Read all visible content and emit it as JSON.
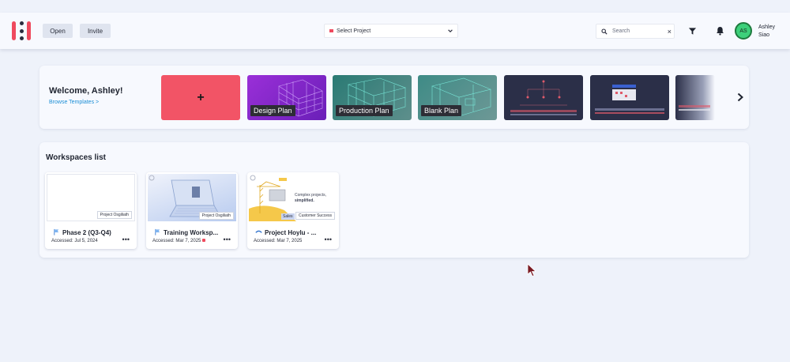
{
  "header": {
    "open_label": "Open",
    "invite_label": "Invite",
    "select_project_label": "Select Project",
    "search_placeholder": "Search",
    "search_clear": "×",
    "avatar_initials": "AS",
    "user_first": "Ashley",
    "user_last": "Siao"
  },
  "welcome": {
    "title": "Welcome, Ashley!",
    "browse_link": "Browse Templates >",
    "new_label": "+",
    "templates": [
      {
        "label": "Design Plan"
      },
      {
        "label": "Production Plan"
      },
      {
        "label": "Blank Plan"
      }
    ]
  },
  "workspaces": {
    "title": "Workspaces list",
    "items": [
      {
        "name": "Phase 2 (Q3-Q4)",
        "tag": "Project Osgiliath",
        "accessed": "Accessed: Jul 5, 2024"
      },
      {
        "name": "Training Worksp...",
        "tag": "Project Osgiliath",
        "accessed": "Accessed: Mar 7, 2025"
      },
      {
        "name": "Project Hoylu - ...",
        "tag": "Customer Success",
        "tag2": "Sales",
        "accessed": "Accessed: Mar 7, 2025",
        "thumb_text1": "Complex projects,",
        "thumb_text2": "simplified."
      }
    ]
  },
  "colors": {
    "accent_red": "#f25466",
    "link_blue": "#1d8fd6",
    "avatar_green": "#3dd07a"
  }
}
